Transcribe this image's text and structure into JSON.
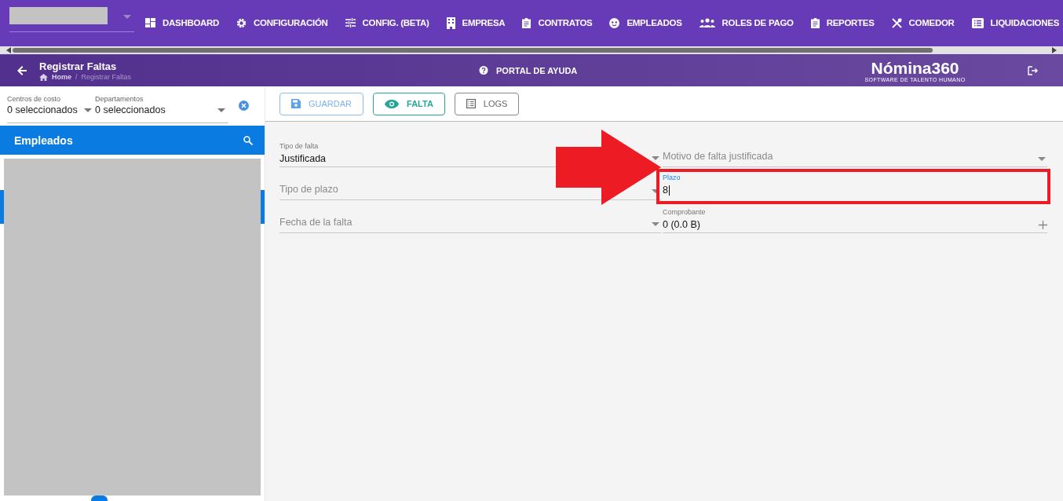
{
  "nav_items": [
    {
      "label": "DASHBOARD"
    },
    {
      "label": "CONFIGURACIÓN"
    },
    {
      "label": "CONFIG. (BETA)"
    },
    {
      "label": "EMPRESA"
    },
    {
      "label": "CONTRATOS"
    },
    {
      "label": "EMPLEADOS"
    },
    {
      "label": "ROLES DE PAGO"
    },
    {
      "label": "REPORTES"
    },
    {
      "label": "COMEDOR"
    },
    {
      "label": "LIQUIDACIONES"
    }
  ],
  "header": {
    "title": "Registrar Faltas",
    "breadcrumb": [
      "Home",
      "Registrar Faltas"
    ],
    "breadcrumb_separator": "/",
    "help": "PORTAL DE AYUDA",
    "logo": "Nómina360",
    "tagline": "SOFTWARE DE TALENTO HUMANO"
  },
  "filters": [
    {
      "label": "Centros de costo",
      "value": "0 seleccionados"
    },
    {
      "label": "Departamentos",
      "value": "0 seleccionados"
    }
  ],
  "employees_title": "Empleados",
  "toolbar": [
    {
      "label": "GUARDAR",
      "kind": "save"
    },
    {
      "label": "FALTA",
      "kind": "view"
    },
    {
      "label": "LOGS",
      "kind": "logs"
    }
  ],
  "form_fields": [
    {
      "label": "Tipo de falta",
      "value": "Justificada",
      "kind": "select",
      "focused": false,
      "highlighted": false
    },
    {
      "label": "Motivo de falta justificada",
      "kind": "select",
      "focused": false,
      "highlighted": false
    },
    {
      "label": "Tipo de plazo",
      "kind": "select",
      "focused": false,
      "highlighted": false
    },
    {
      "label": "Plazo",
      "value": "8",
      "kind": "text",
      "focused": true,
      "highlighted": true
    },
    {
      "label": "Fecha de la falta",
      "kind": "select",
      "focused": false,
      "highlighted": false
    },
    {
      "label": "Comprobante",
      "value": "0 (0.0 B)",
      "kind": "file",
      "focused": false,
      "highlighted": false
    }
  ]
}
